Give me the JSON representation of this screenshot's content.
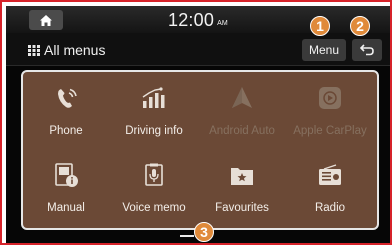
{
  "status_bar": {
    "home_icon": "home-icon",
    "time": "12:00",
    "ampm": "AM"
  },
  "title_bar": {
    "title": "All menus",
    "grid_icon": "grid-icon",
    "menu_button_label": "Menu",
    "back_icon": "back-arrow-icon"
  },
  "apps": [
    {
      "label": "Phone",
      "icon": "phone-icon",
      "enabled": true
    },
    {
      "label": "Driving info",
      "icon": "driving-info-icon",
      "enabled": true
    },
    {
      "label": "Android Auto",
      "icon": "android-auto-icon",
      "enabled": false
    },
    {
      "label": "Apple CarPlay",
      "icon": "apple-carplay-icon",
      "enabled": false
    },
    {
      "label": "Manual",
      "icon": "manual-icon",
      "enabled": true
    },
    {
      "label": "Voice memo",
      "icon": "voice-memo-icon",
      "enabled": true
    },
    {
      "label": "Favourites",
      "icon": "favourites-icon",
      "enabled": true
    },
    {
      "label": "Radio",
      "icon": "radio-icon",
      "enabled": true
    }
  ],
  "callouts": [
    "1",
    "2",
    "3"
  ],
  "colors": {
    "tile_background": "#6b4936",
    "callout": "#e08a3a",
    "frame_border": "#d6232a"
  }
}
